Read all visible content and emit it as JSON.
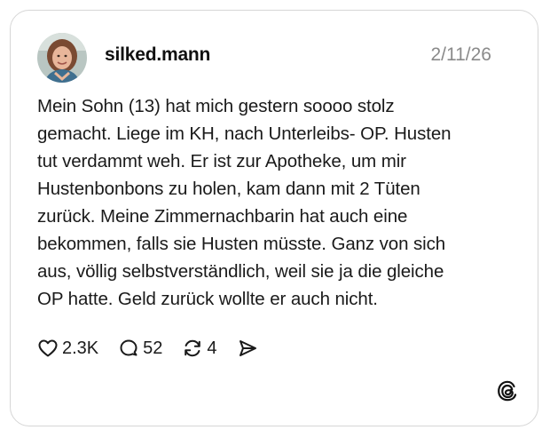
{
  "post": {
    "username": "silked.mann",
    "date": "2/11/26",
    "text": "Mein Sohn (13) hat mich gestern soooo stolz\ngemacht. Liege im KH, nach Unterleibs- OP. Husten\ntut verdammt weh. Er ist zur Apotheke, um mir\nHustenbonbons zu holen, kam dann mit 2 Tüten\nzurück. Meine Zimmernachbarin hat auch eine\nbekommen, falls sie Husten müsste. Ganz von sich\naus, völlig selbstverständlich, weil sie ja die gleiche\nOP hatte. Geld zurück wollte er auch nicht."
  },
  "actions": {
    "likes": "2.3K",
    "replies": "52",
    "reposts": "4"
  },
  "icons": {
    "like": "heart-icon",
    "reply": "speech-bubble-icon",
    "repost": "repost-icon",
    "share": "send-icon",
    "brand": "threads-logo-icon"
  },
  "colors": {
    "text": "#1a1a1a",
    "muted": "#8a8a8a",
    "border": "#d6d6d6"
  }
}
